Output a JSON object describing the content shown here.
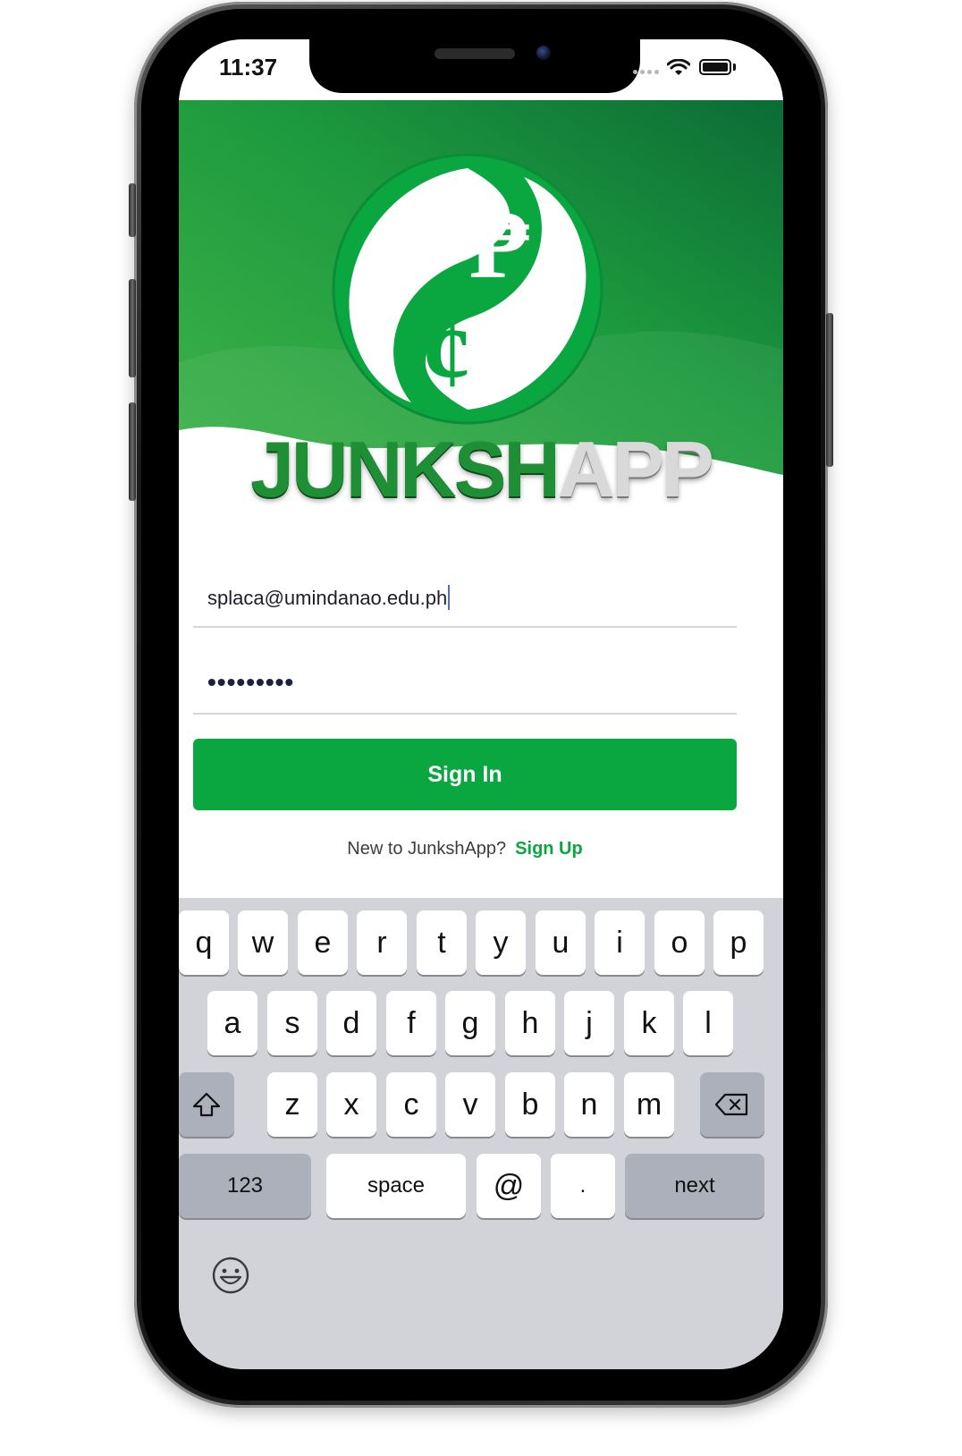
{
  "status_bar": {
    "time": "11:37"
  },
  "brand": {
    "name_part1": "JUNKSH",
    "name_part2": "APP",
    "logo_glyph_top": "₱",
    "logo_glyph_bottom": "¢",
    "primary_color": "#0aa640"
  },
  "login_form": {
    "email_value": "splaca@umindanao.edu.ph",
    "password_masked": "•••••••••",
    "sign_in_label": "Sign In",
    "signup_prompt": "New to JunkshApp?",
    "signup_link": "Sign Up"
  },
  "keyboard": {
    "row1": [
      "q",
      "w",
      "e",
      "r",
      "t",
      "y",
      "u",
      "i",
      "o",
      "p"
    ],
    "row2": [
      "a",
      "s",
      "d",
      "f",
      "g",
      "h",
      "j",
      "k",
      "l"
    ],
    "row3": [
      "z",
      "x",
      "c",
      "v",
      "b",
      "n",
      "m"
    ],
    "numbers_label": "123",
    "space_label": "space",
    "at_label": "@",
    "dot_label": ".",
    "next_label": "next",
    "shift_icon": "shift-icon",
    "delete_icon": "backspace-icon",
    "emoji_icon": "emoji-icon"
  }
}
